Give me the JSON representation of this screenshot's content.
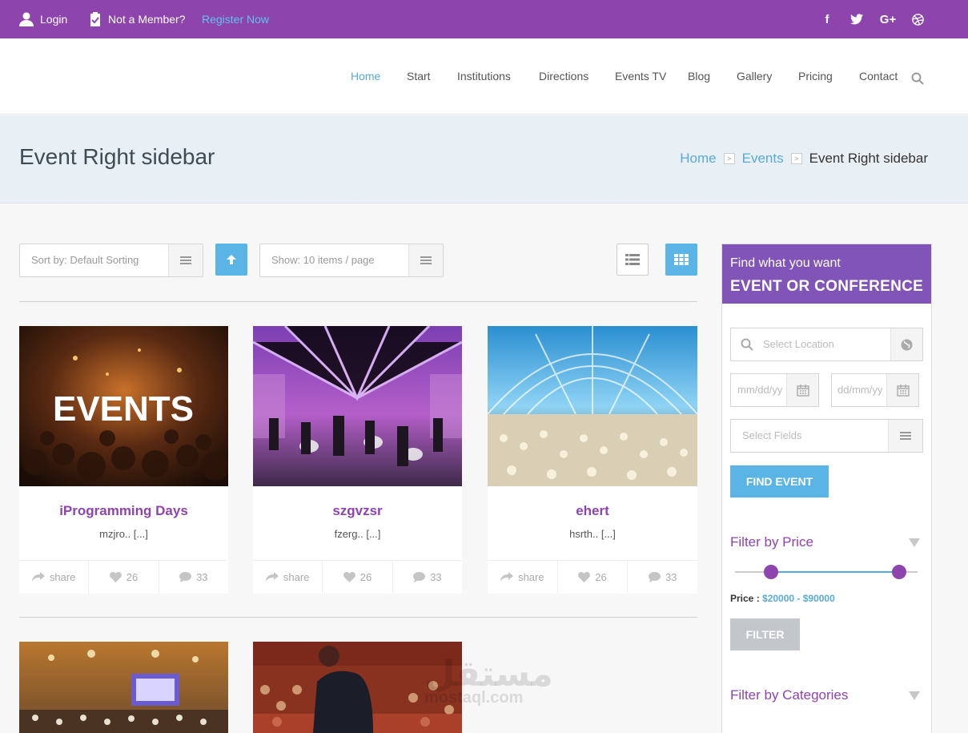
{
  "topbar": {
    "login": "Login",
    "not_member": "Not a Member?",
    "register": "Register Now",
    "social": [
      "facebook-icon",
      "twitter-icon",
      "google-plus-icon",
      "dribbble-icon"
    ],
    "social_glyphs": {
      "facebook": "f",
      "google_plus": "G+"
    }
  },
  "nav": {
    "items": [
      "Home",
      "Start",
      "Institutions",
      "Directions",
      "Events TV",
      "Blog",
      "Gallery",
      "Pricing",
      "Contact"
    ],
    "active": "Home"
  },
  "header": {
    "title": "Event Right sidebar",
    "breadcrumb": [
      "Home",
      "Events",
      "Event Right sidebar"
    ]
  },
  "toolbar": {
    "sort_placeholder": "Sort by: Default Sorting",
    "show_placeholder": "Show: 10 items / page"
  },
  "events": [
    {
      "title": "iProgramming Days",
      "excerpt": "mzjro.. [...]",
      "share": "share",
      "likes": "26",
      "comments": "33",
      "image_text": "EVENTS"
    },
    {
      "title": "szgvzsr",
      "excerpt": "fzerg.. [...]",
      "share": "share",
      "likes": "26",
      "comments": "33"
    },
    {
      "title": "ehert",
      "excerpt": "hsrth.. [...]",
      "share": "share",
      "likes": "26",
      "comments": "33"
    }
  ],
  "sidebar": {
    "intro": "Find what you want",
    "heading": "EVENT OR CONFERENCE",
    "location_placeholder": "Select Location",
    "date_from_placeholder": "mm/dd/yy",
    "date_to_placeholder": "dd/mm/yy",
    "fields_placeholder": "Select Fields",
    "find_button": "FIND EVENT",
    "price_filter_title": "Filter by Price",
    "price_label": "Price :",
    "price_range": "$20000 - $90000",
    "filter_button": "FILTER",
    "categories_title": "Filter by Categories"
  },
  "watermark": {
    "arabic": "مستقل",
    "latin": "mostaql.com"
  },
  "colors": {
    "brand_purple": "#8e44ad",
    "accent_blue": "#5ab4e5",
    "sidebar_header": "#8155b8"
  }
}
